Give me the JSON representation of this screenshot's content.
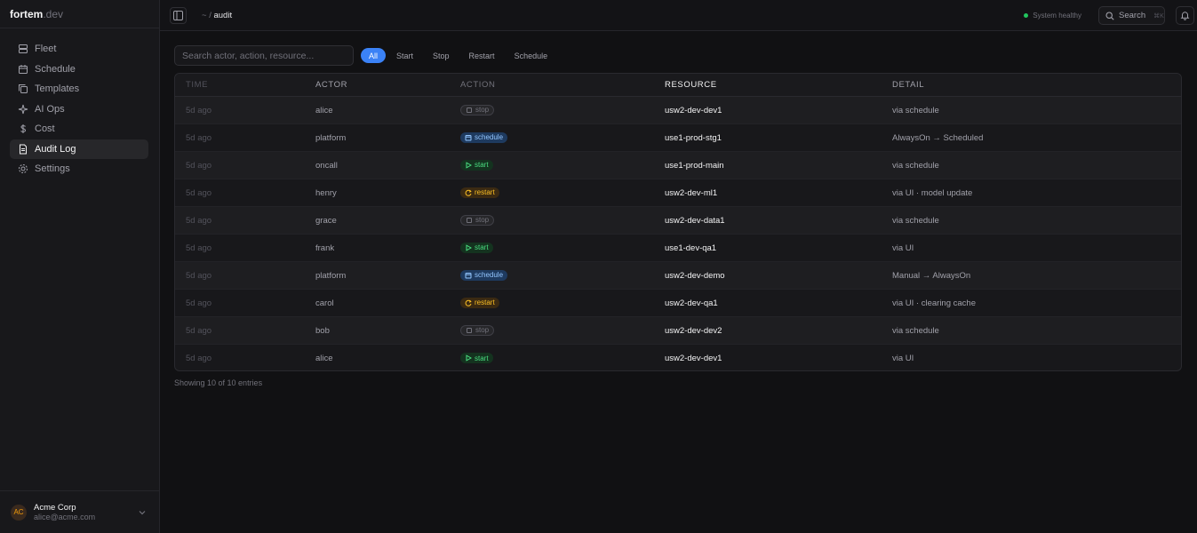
{
  "brand": {
    "name": "fortem",
    "suffix": ".dev"
  },
  "sidebar": {
    "items": [
      {
        "label": "Fleet",
        "icon": "server-icon",
        "active": false
      },
      {
        "label": "Schedule",
        "icon": "calendar-icon",
        "active": false
      },
      {
        "label": "Templates",
        "icon": "copy-icon",
        "active": false
      },
      {
        "label": "AI Ops",
        "icon": "sparkle-icon",
        "active": false
      },
      {
        "label": "Cost",
        "icon": "dollar-icon",
        "active": false
      },
      {
        "label": "Audit Log",
        "icon": "document-icon",
        "active": true
      },
      {
        "label": "Settings",
        "icon": "gear-icon",
        "active": false
      }
    ],
    "footer": {
      "initials": "AC",
      "org": "Acme Corp",
      "email": "alice@acme.com"
    }
  },
  "topbar": {
    "breadcrumb_root": "~",
    "breadcrumb_sep": "/",
    "breadcrumb_current": "audit",
    "status": "System healthy",
    "search_label": "Search",
    "search_shortcut": "⌘K"
  },
  "filters": {
    "search_placeholder": "Search actor, action, resource...",
    "pills": [
      "All",
      "Start",
      "Stop",
      "Restart",
      "Schedule"
    ],
    "active": "All"
  },
  "table": {
    "headers": [
      "TIME",
      "ACTOR",
      "ACTION",
      "RESOURCE",
      "DETAIL"
    ],
    "rows": [
      {
        "time": "5d ago",
        "actor": "alice",
        "action": "stop",
        "resource": "usw2-dev-dev1",
        "detail": "via schedule"
      },
      {
        "time": "5d ago",
        "actor": "platform",
        "action": "schedule",
        "resource": "use1-prod-stg1",
        "detail": "AlwaysOn → Scheduled"
      },
      {
        "time": "5d ago",
        "actor": "oncall",
        "action": "start",
        "resource": "use1-prod-main",
        "detail": "via schedule"
      },
      {
        "time": "5d ago",
        "actor": "henry",
        "action": "restart",
        "resource": "usw2-dev-ml1",
        "detail": "via UI · model update"
      },
      {
        "time": "5d ago",
        "actor": "grace",
        "action": "stop",
        "resource": "usw2-dev-data1",
        "detail": "via schedule"
      },
      {
        "time": "5d ago",
        "actor": "frank",
        "action": "start",
        "resource": "use1-dev-qa1",
        "detail": "via UI"
      },
      {
        "time": "5d ago",
        "actor": "platform",
        "action": "schedule",
        "resource": "usw2-dev-demo",
        "detail": "Manual → AlwaysOn"
      },
      {
        "time": "5d ago",
        "actor": "carol",
        "action": "restart",
        "resource": "usw2-dev-qa1",
        "detail": "via UI · clearing cache"
      },
      {
        "time": "5d ago",
        "actor": "bob",
        "action": "stop",
        "resource": "usw2-dev-dev2",
        "detail": "via schedule"
      },
      {
        "time": "5d ago",
        "actor": "alice",
        "action": "start",
        "resource": "usw2-dev-dev1",
        "detail": "via UI"
      }
    ]
  },
  "footer_note": "Showing 10 of 10 entries",
  "colors": {
    "accent": "#3b82f6",
    "healthy": "#22c55e"
  }
}
